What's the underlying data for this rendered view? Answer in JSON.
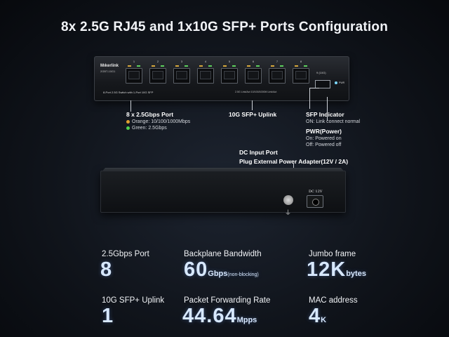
{
  "title": "8x 2.5G RJ45 and 1x10G SFP+ Ports Configuration",
  "front": {
    "brand": "Mıkerlink",
    "model": "2GBT-10G1",
    "caption": "8-Port 2.5G Switch with 1-Port 10G SFP",
    "legend": "2.5G Link/Act     10/100/1000M Link/Act",
    "port_numbers": [
      "1",
      "2",
      "3",
      "4",
      "5",
      "6",
      "7",
      "8"
    ],
    "sfp_label": "9 (10G)",
    "pwr_text": "PWR"
  },
  "annotations": {
    "port": {
      "title": "8 x 2.5Gbps Port",
      "orange": "Orange: 10/100/1000Mbps",
      "green": "Green: 2.5Gbps",
      "orange_color": "#e0a030",
      "green_color": "#4fd04f"
    },
    "uplink": {
      "title": "10G SFP+ Uplink"
    },
    "sfp_indicator": {
      "title": "SFP Indicator",
      "desc": "ON: Link connect normal"
    },
    "power": {
      "title": "PWR(Power)",
      "on": "On: Powered on",
      "off": "Off: Powered off"
    },
    "dc": {
      "title": "DC Input Port",
      "desc": "Plug External Power Adapter(12V / 2A)"
    }
  },
  "rear": {
    "dc_label": "DC 12V"
  },
  "specs": [
    {
      "label": "2.5Gbps Port",
      "value": "8",
      "unit": ""
    },
    {
      "label": "Backplane Bandwidth",
      "value": "60",
      "unit": "Gbps",
      "unit_note": "(non-blocking)"
    },
    {
      "label": "Jumbo frame",
      "value": "12K",
      "unit": "bytes"
    },
    {
      "label": "10G SFP+ Uplink",
      "value": "1",
      "unit": ""
    },
    {
      "label": "Packet Forwarding Rate",
      "value": "44.64",
      "unit": "Mpps"
    },
    {
      "label": "MAC address",
      "value": "4",
      "unit": "K"
    }
  ]
}
